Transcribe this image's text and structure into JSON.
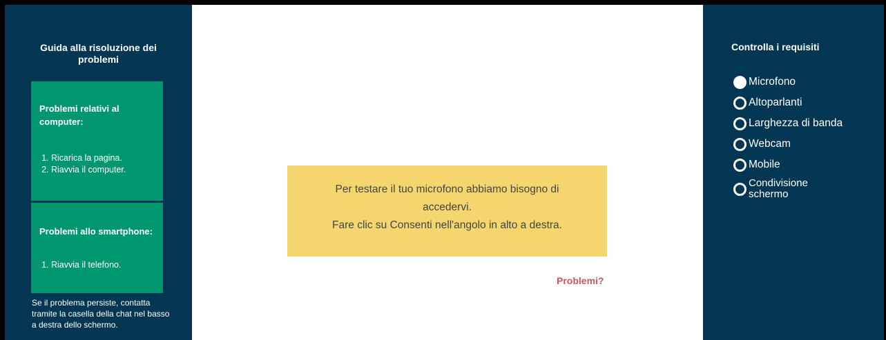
{
  "left_panel": {
    "title": "Guida alla risoluzione dei problemi",
    "computer_card": {
      "title": "Problemi relativi al computer:",
      "items": [
        "Ricarica la pagina.",
        "Riavvia il computer."
      ]
    },
    "smartphone_card": {
      "title": "Problemi allo smartphone:",
      "items": [
        "Riavvia il telefono."
      ]
    },
    "footer": "Se il problema persiste, contatta tramite la casella della chat nel basso a destra dello schermo."
  },
  "notice": {
    "line1": "Per testare il tuo microfono abbiamo bisogno di accedervi.",
    "line2": "Fare clic su Consenti nell'angolo in alto a destra."
  },
  "problems_link": "Problemi?",
  "right_panel": {
    "title": "Controlla i requisiti",
    "requirements": [
      {
        "label": "Microfono",
        "active": true
      },
      {
        "label": "Altoparlanti",
        "active": false
      },
      {
        "label": "Larghezza di banda",
        "active": false
      },
      {
        "label": "Webcam",
        "active": false
      },
      {
        "label": "Mobile",
        "active": false
      },
      {
        "label": "Condivisione schermo",
        "active": false
      }
    ]
  },
  "colors": {
    "panel_bg": "#023653",
    "card_bg": "#00976f",
    "notice_bg": "#f5d66e",
    "link": "#c7585b"
  }
}
